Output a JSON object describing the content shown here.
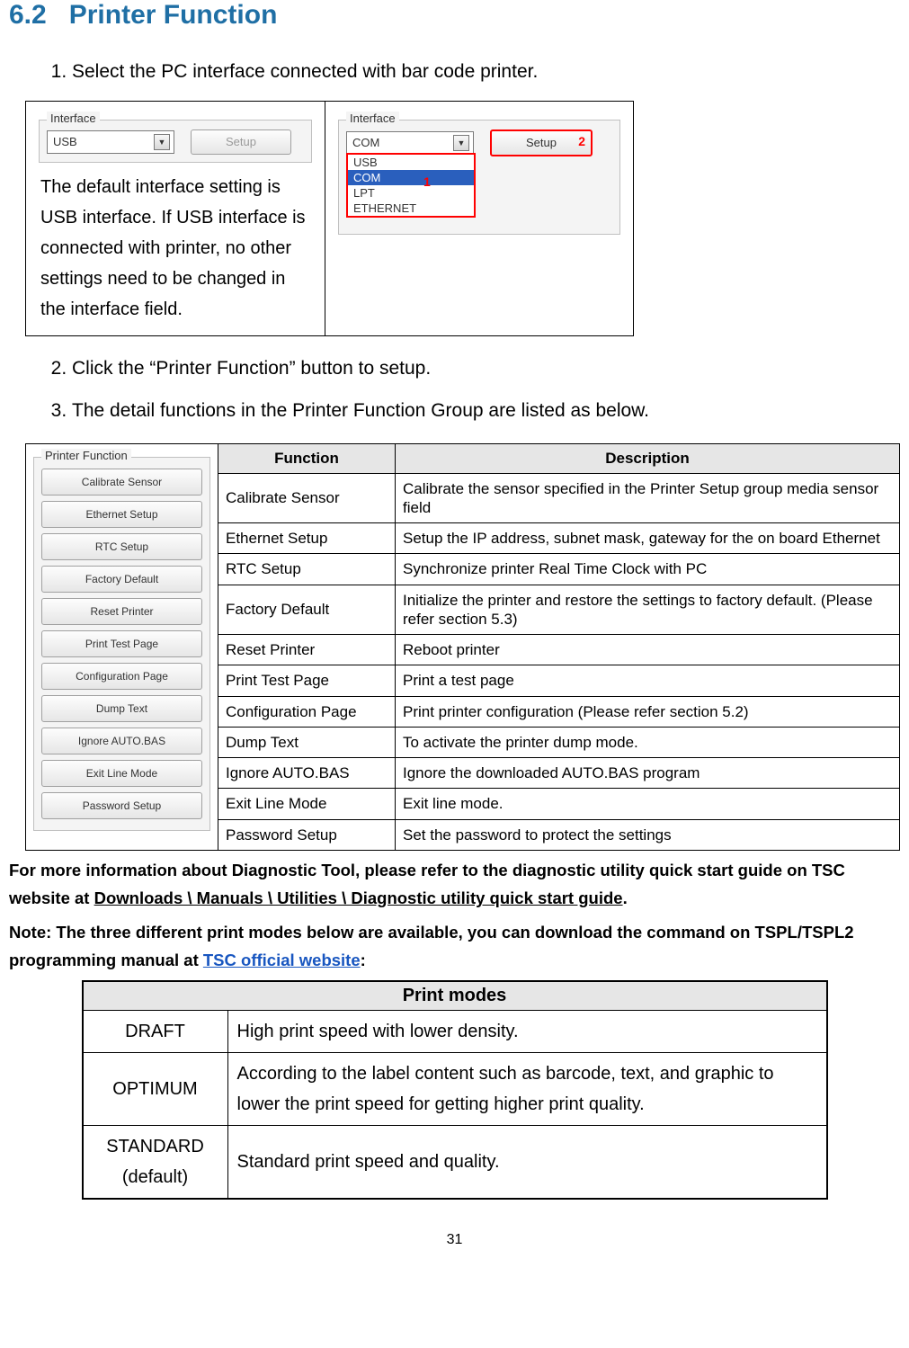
{
  "section": {
    "number": "6.2",
    "title": "Printer Function"
  },
  "steps": {
    "s1": "Select the PC interface connected with bar code printer.",
    "s2": "Click the “Printer Function” button to setup.",
    "s3": "The detail functions in the Printer Function Group are listed as below."
  },
  "interfaceBox": {
    "groupLabel": "Interface",
    "usbValue": "USB",
    "setupDisabled": "Setup",
    "caption": "The default interface setting is USB interface. If USB interface is connected with printer, no other settings need to be changed in the interface field.",
    "comValue": "COM",
    "setupEnabled": "Setup",
    "badge1": "1",
    "badge2": "2",
    "options": {
      "o0": "USB",
      "o1": "COM",
      "o2": "LPT",
      "o3": "ETHERNET"
    }
  },
  "printerFunction": {
    "groupLabel": "Printer Function",
    "buttons": {
      "b0": "Calibrate Sensor",
      "b1": "Ethernet Setup",
      "b2": "RTC Setup",
      "b3": "Factory Default",
      "b4": "Reset Printer",
      "b5": "Print Test Page",
      "b6": "Configuration Page",
      "b7": "Dump Text",
      "b8": "Ignore AUTO.BAS",
      "b9": "Exit Line Mode",
      "b10": "Password Setup"
    }
  },
  "funcTable": {
    "hFunction": "Function",
    "hDescription": "Description",
    "rows": {
      "r0": {
        "f": "Calibrate Sensor",
        "d": "Calibrate the sensor specified in the Printer Setup group media sensor field"
      },
      "r1": {
        "f": "Ethernet Setup",
        "d": "Setup the IP address, subnet mask, gateway for the on board Ethernet"
      },
      "r2": {
        "f": "RTC Setup",
        "d": "Synchronize printer Real Time Clock with PC"
      },
      "r3": {
        "f": "Factory Default",
        "d": "Initialize the printer and restore the settings to factory default. (Please refer section 5.3)"
      },
      "r4": {
        "f": "Reset Printer",
        "d": "Reboot printer"
      },
      "r5": {
        "f": "Print Test Page",
        "d": "Print a test page"
      },
      "r6": {
        "f": "Configuration Page",
        "d": "Print printer configuration (Please refer section 5.2)"
      },
      "r7": {
        "f": "Dump Text",
        "d": "To activate the printer dump mode."
      },
      "r8": {
        "f": "Ignore AUTO.BAS",
        "d": "Ignore the downloaded AUTO.BAS program"
      },
      "r9": {
        "f": "Exit Line Mode",
        "d": "Exit line mode."
      },
      "r10": {
        "f": "Password Setup",
        "d": "Set the password to protect the settings"
      }
    }
  },
  "notes": {
    "line1a": "For more information about Diagnostic Tool, please refer to the diagnostic utility quick start guide on TSC website at ",
    "line1b": "Downloads \\ Manuals \\ Utilities \\ Diagnostic utility quick start guide",
    "line1c": ".",
    "line2a": "Note: The three different print modes below are available, you can download the command on TSPL/TSPL2 programming manual at ",
    "line2b": "TSC official website",
    "line2c": ":"
  },
  "modes": {
    "header": "Print modes",
    "r0": {
      "name": "DRAFT",
      "desc": "High print speed with lower density."
    },
    "r1": {
      "name": "OPTIMUM",
      "desc": "According to the label content such as barcode, text, and graphic to lower the print speed for getting higher print quality."
    },
    "r2": {
      "name": "STANDARD (default)",
      "desc": "Standard print speed and quality."
    }
  },
  "pageNumber": "31"
}
